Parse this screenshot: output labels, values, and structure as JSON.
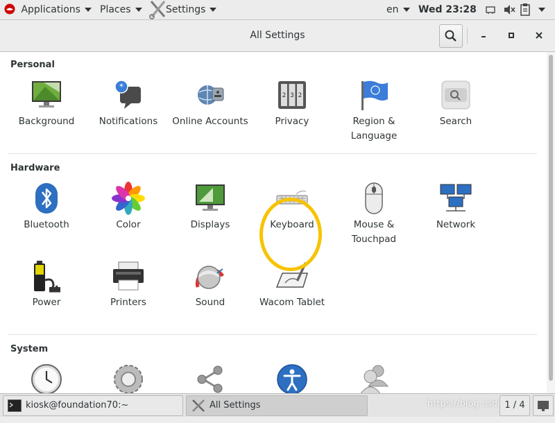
{
  "top_bar": {
    "applications": "Applications",
    "places": "Places",
    "settings": "Settings",
    "language": "en",
    "clock": "Wed 23:28"
  },
  "window": {
    "title": "All Settings"
  },
  "sections": {
    "personal": {
      "title": "Personal",
      "items": [
        {
          "label": "Background",
          "icon": "background-icon"
        },
        {
          "label": "Notifications",
          "icon": "notifications-icon"
        },
        {
          "label": "Online Accounts",
          "icon": "online-accounts-icon"
        },
        {
          "label": "Privacy",
          "icon": "privacy-icon"
        },
        {
          "label": "Region & Language",
          "icon": "region-language-icon"
        },
        {
          "label": "Search",
          "icon": "search-settings-icon"
        }
      ]
    },
    "hardware": {
      "title": "Hardware",
      "items": [
        {
          "label": "Bluetooth",
          "icon": "bluetooth-icon"
        },
        {
          "label": "Color",
          "icon": "color-icon"
        },
        {
          "label": "Displays",
          "icon": "displays-icon"
        },
        {
          "label": "Keyboard",
          "icon": "keyboard-icon"
        },
        {
          "label": "Mouse & Touchpad",
          "icon": "mouse-icon"
        },
        {
          "label": "Network",
          "icon": "network-icon"
        },
        {
          "label": "Power",
          "icon": "power-icon"
        },
        {
          "label": "Printers",
          "icon": "printers-icon"
        },
        {
          "label": "Sound",
          "icon": "sound-icon"
        },
        {
          "label": "Wacom Tablet",
          "icon": "wacom-tablet-icon"
        }
      ]
    },
    "system": {
      "title": "System",
      "items": [
        {
          "label": "",
          "icon": "date-time-icon"
        },
        {
          "label": "",
          "icon": "details-icon"
        },
        {
          "label": "",
          "icon": "sharing-icon"
        },
        {
          "label": "",
          "icon": "universal-access-icon"
        },
        {
          "label": "",
          "icon": "users-icon"
        }
      ]
    }
  },
  "taskbar": {
    "terminal_task": "kiosk@foundation70:~",
    "settings_task": "All Settings",
    "workspace": "1 / 4",
    "watermark": "https://blog.csdn.net/l"
  },
  "colors": {
    "highlight_circle": "#f7c300",
    "bluetooth_blue": "#2d6fc1"
  }
}
